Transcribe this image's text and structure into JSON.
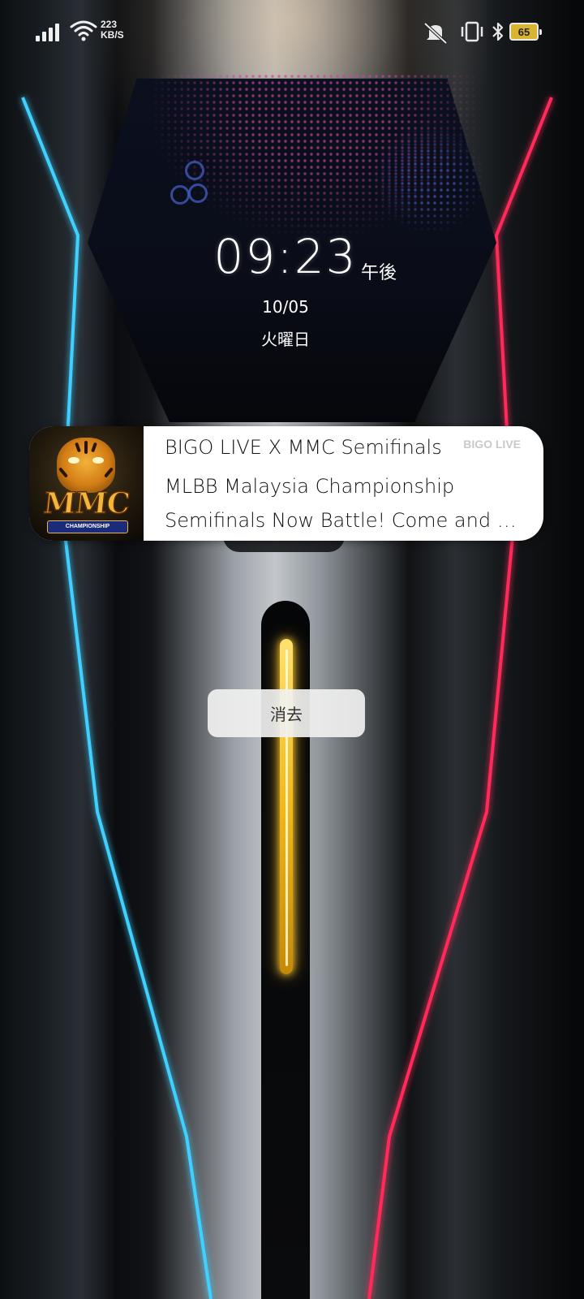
{
  "status_bar": {
    "net_speed_value": "223",
    "net_speed_unit": "KB/S",
    "battery_level": "65",
    "icons": [
      "signal-icon",
      "wifi-icon",
      "mute-icon",
      "vibrate-icon",
      "bluetooth-icon",
      "battery-icon"
    ]
  },
  "lockscreen": {
    "time": "09:23",
    "ampm": "午後",
    "date": "10/05",
    "weekday": "火曜日"
  },
  "notification": {
    "app_name": "BIGO LIVE",
    "title": "BIGO LIVE X MMC Semifinals",
    "line1": "MLBB Malaysia Championship",
    "line2": "Semifinals Now Battle! Come and watch now!",
    "thumbnail_text": "MMC",
    "thumbnail_caption": "CHAMPIONSHIP"
  },
  "actions": {
    "dismiss_label": "消去"
  },
  "colors": {
    "neon_blue": "#3fd0ff",
    "neon_red": "#ff2a5a",
    "gold": "#f1b81a",
    "battery_fill": "#d9b431"
  }
}
